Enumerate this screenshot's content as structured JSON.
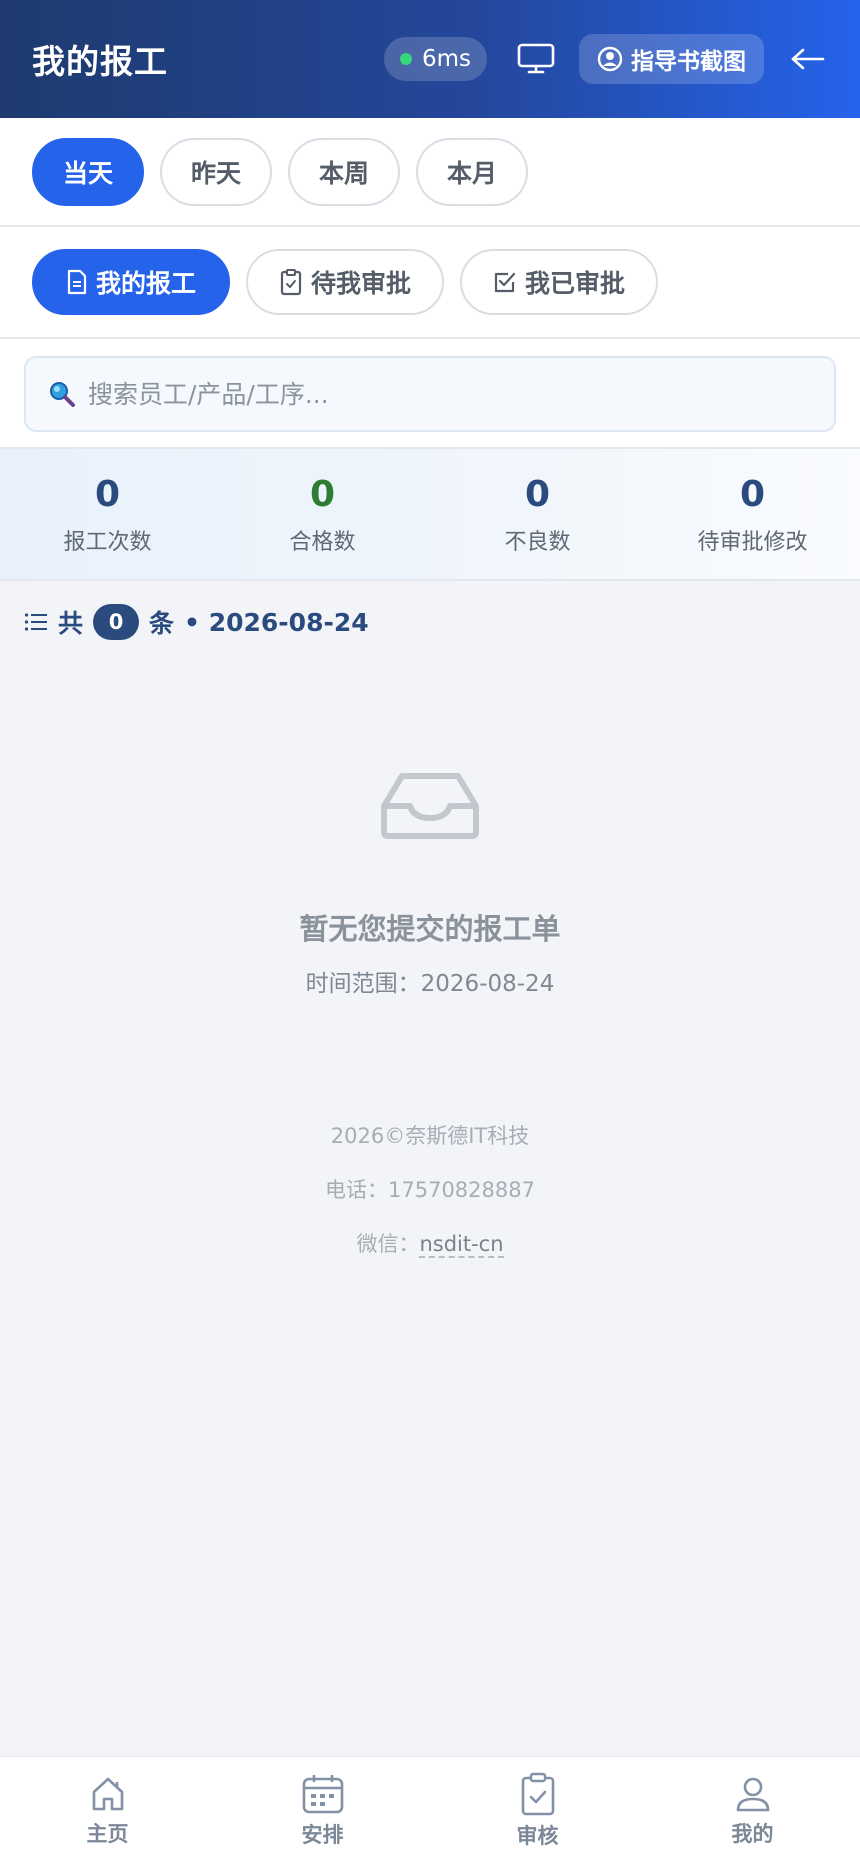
{
  "header": {
    "title": "我的报工",
    "latency": "6ms",
    "guide_label": "指导书截图"
  },
  "period_tabs": [
    {
      "label": "当天",
      "active": true
    },
    {
      "label": "昨天",
      "active": false
    },
    {
      "label": "本周",
      "active": false
    },
    {
      "label": "本月",
      "active": false
    }
  ],
  "type_tabs": [
    {
      "label": "我的报工",
      "icon": "document-icon",
      "active": true
    },
    {
      "label": "待我审批",
      "icon": "clipboard-icon",
      "active": false
    },
    {
      "label": "我已审批",
      "icon": "checkbox-icon",
      "active": false
    }
  ],
  "search": {
    "placeholder": "搜索员工/产品/工序..."
  },
  "stats": [
    {
      "value": "0",
      "label": "报工次数"
    },
    {
      "value": "0",
      "label": "合格数"
    },
    {
      "value": "0",
      "label": "不良数"
    },
    {
      "value": "0",
      "label": "待审批修改"
    }
  ],
  "list_summary": {
    "prefix": "共",
    "count": "0",
    "suffix": "条",
    "date": "• 2026-08-24"
  },
  "empty_state": {
    "message": "暂无您提交的报工单",
    "range": "时间范围：2026-08-24"
  },
  "footer": {
    "copyright": "2026©奈斯德IT科技",
    "phone": "电话：17570828887",
    "wechat_prefix": "微信：",
    "wechat_id": "nsdit-cn"
  },
  "bottom_nav": [
    {
      "label": "主页",
      "icon": "home-icon"
    },
    {
      "label": "安排",
      "icon": "calendar-icon"
    },
    {
      "label": "审核",
      "icon": "clipboard-check-icon"
    },
    {
      "label": "我的",
      "icon": "user-icon"
    }
  ],
  "colors": {
    "primary": "#2563eb",
    "header_start": "#1e3a6e",
    "accent_dark": "#2b4a7e",
    "good": "#2e7d32",
    "online": "#36d67a"
  }
}
